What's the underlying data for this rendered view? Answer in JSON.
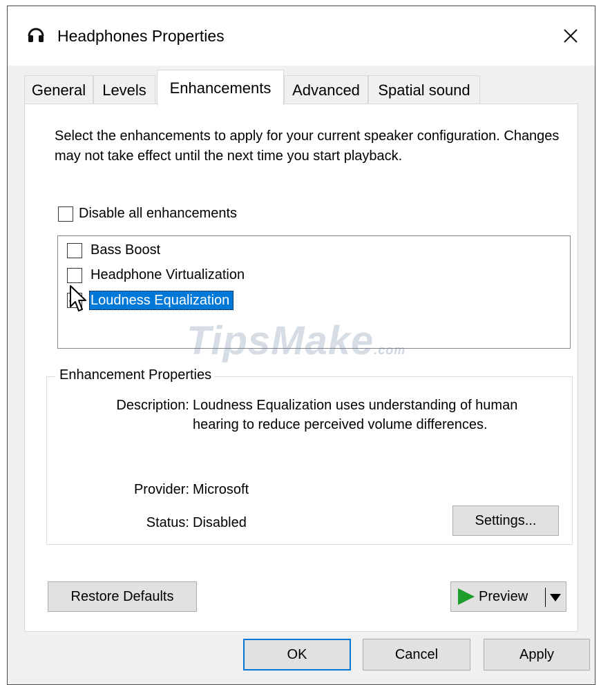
{
  "window": {
    "title": "Headphones Properties",
    "close_glyph": "×"
  },
  "tabs": [
    {
      "label": "General",
      "active": false
    },
    {
      "label": "Levels",
      "active": false
    },
    {
      "label": "Enhancements",
      "active": true
    },
    {
      "label": "Advanced",
      "active": false
    },
    {
      "label": "Spatial sound",
      "active": false
    }
  ],
  "panel": {
    "description": "Select the enhancements to apply for your current speaker configuration. Changes may not take effect until the next time you start playback.",
    "disable_all": {
      "label": "Disable all enhancements",
      "checked": false
    },
    "enhancements": [
      {
        "label": "Bass Boost",
        "checked": false,
        "selected": false
      },
      {
        "label": "Headphone Virtualization",
        "checked": false,
        "selected": false
      },
      {
        "label": "Loudness Equalization",
        "checked": true,
        "selected": true
      }
    ],
    "properties": {
      "group_title": "Enhancement Properties",
      "description_label": "Description:",
      "description_value": "Loudness Equalization uses understanding of human hearing to reduce perceived volume differences.",
      "provider_label": "Provider:",
      "provider_value": "Microsoft",
      "status_label": "Status:",
      "status_value": "Disabled",
      "settings_button": "Settings..."
    },
    "restore_defaults_button": "Restore Defaults",
    "preview_button": "Preview"
  },
  "footer": {
    "ok": "OK",
    "cancel": "Cancel",
    "apply": "Apply"
  },
  "watermark": {
    "main": "TipsMake",
    "suffix": ".com"
  },
  "colors": {
    "selection": "#0078d7",
    "preview_icon": "#1b9e2a",
    "panel_bg": "#ffffff",
    "window_bg": "#f0f0f0"
  }
}
